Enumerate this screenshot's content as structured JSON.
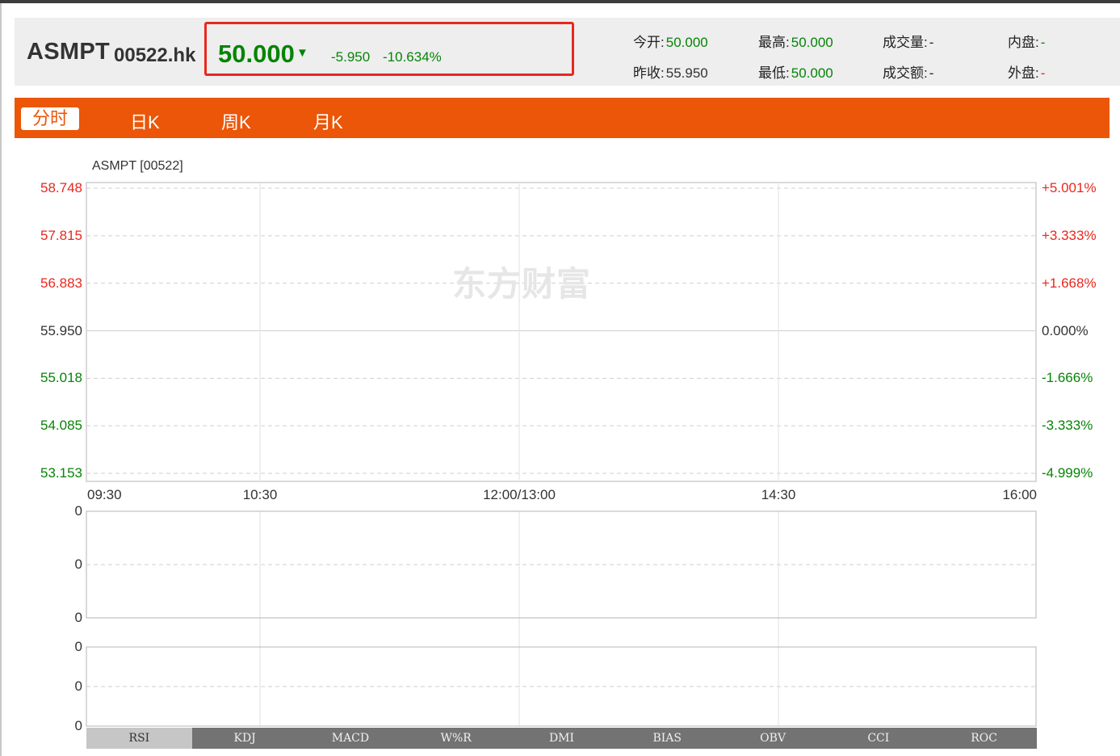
{
  "stock": {
    "name": "ASMPT",
    "code": "00522.hk",
    "price": "50.000",
    "change": "-5.950",
    "change_pct": "-10.634%"
  },
  "stats": {
    "open_label": "今开:",
    "open_value": "50.000",
    "high_label": "最高:",
    "high_value": "50.000",
    "volume_label": "成交量:",
    "volume_value": "-",
    "inner_label": "内盘:",
    "inner_value": "-",
    "prev_close_label": "昨收:",
    "prev_close_value": "55.950",
    "low_label": "最低:",
    "low_value": "50.000",
    "amount_label": "成交额:",
    "amount_value": "-",
    "outer_label": "外盘:",
    "outer_value": "-"
  },
  "tabs": [
    "分时",
    "日K",
    "周K",
    "月K"
  ],
  "chart": {
    "title": "ASMPT [00522]",
    "watermark": "东方财富"
  },
  "chart_data": {
    "type": "line",
    "title": "ASMPT [00522]",
    "x_ticks": [
      "09:30",
      "10:30",
      "12:00/13:00",
      "14:30",
      "16:00"
    ],
    "y_ticks": [
      "58.748",
      "57.815",
      "56.883",
      "55.950",
      "55.018",
      "54.085",
      "53.153"
    ],
    "y2_ticks": [
      "+5.001%",
      "+3.333%",
      "+1.668%",
      "0.000%",
      "-1.666%",
      "-3.333%",
      "-4.999%"
    ],
    "ylim": [
      53.153,
      58.748
    ],
    "series": [],
    "colors": {
      "up": "#e8281e",
      "down": "#068406",
      "flat": "#333333"
    }
  },
  "indicator_axes": {
    "upper": [
      "0",
      "0",
      "0"
    ],
    "lower": [
      "0",
      "0",
      "0"
    ]
  },
  "indicator_tabs": [
    "RSI",
    "KDJ",
    "MACD",
    "W%R",
    "DMI",
    "BIAS",
    "OBV",
    "CCI",
    "ROC"
  ],
  "accent": "#eb5608"
}
